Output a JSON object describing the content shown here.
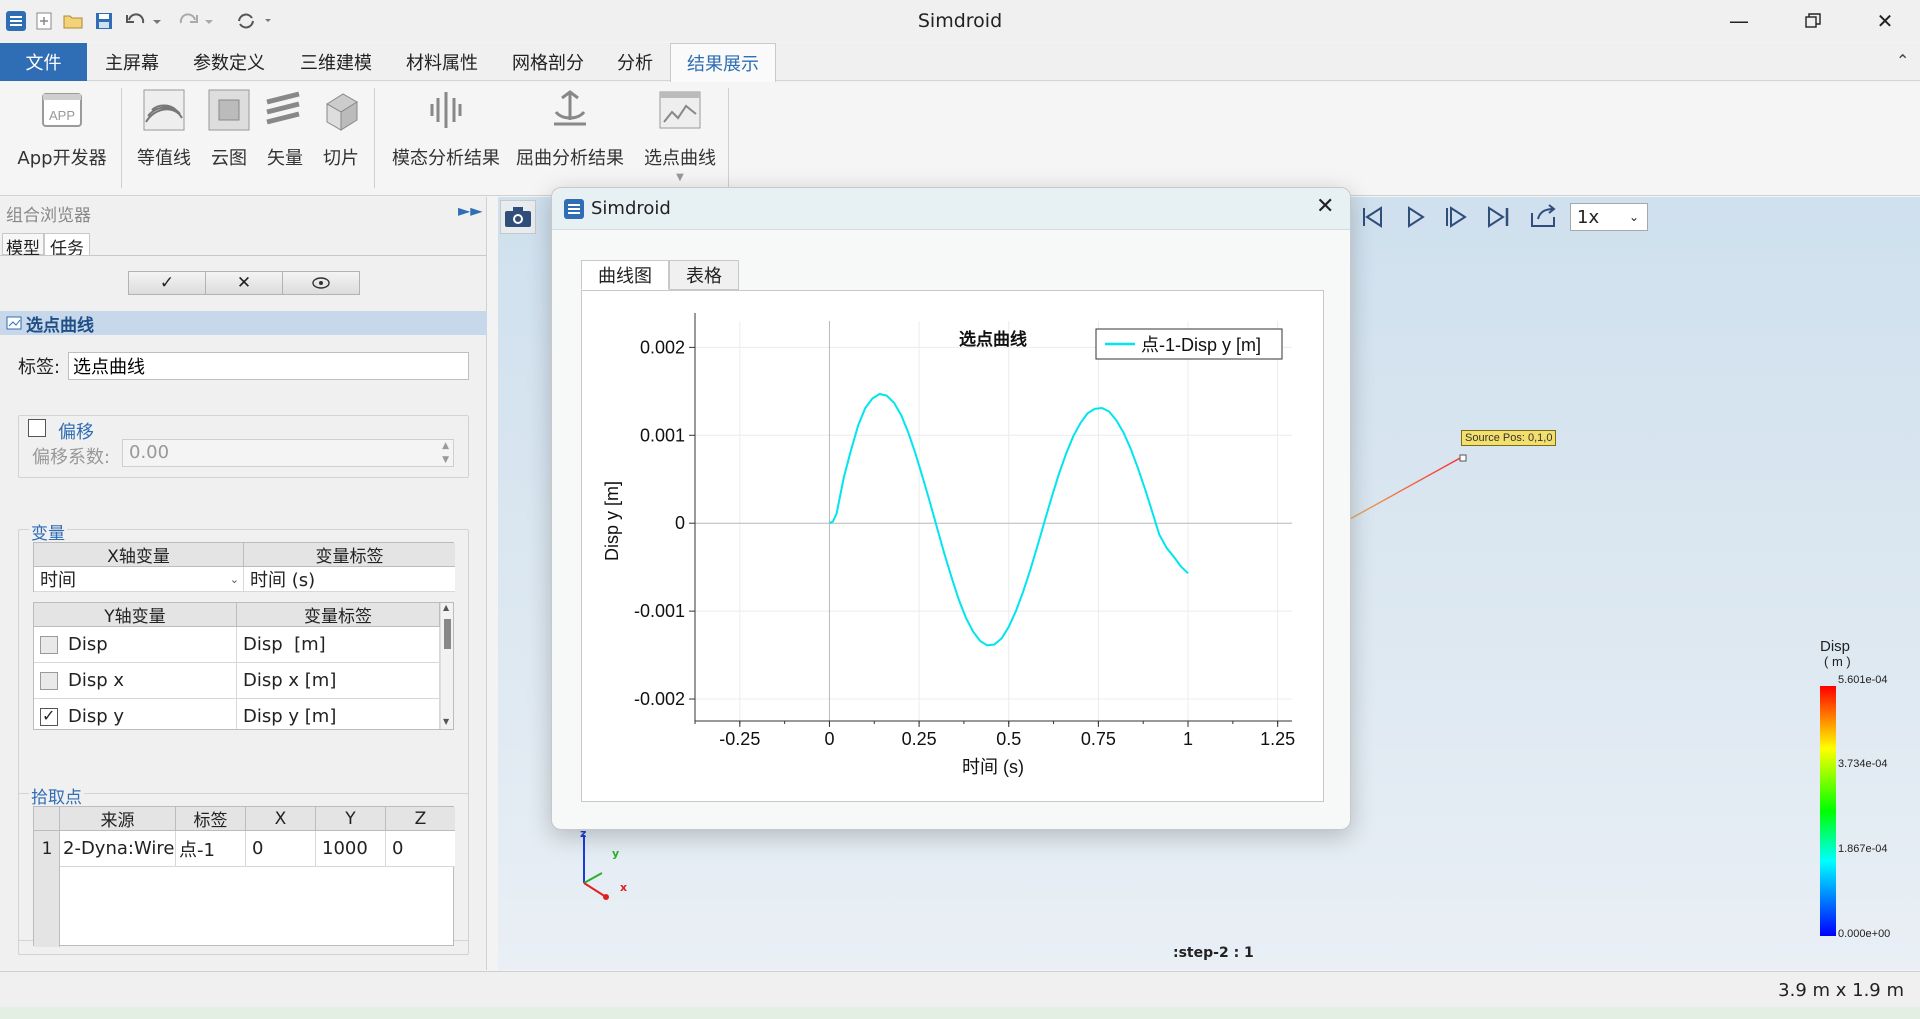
{
  "window": {
    "title": "Simdroid"
  },
  "menu": {
    "file": "文件",
    "items": [
      "主屏幕",
      "参数定义",
      "三维建模",
      "材料属性",
      "网格剖分",
      "分析"
    ],
    "active": "结果展示"
  },
  "ribbon": {
    "buttons": [
      "App开发器",
      "等值线",
      "云图",
      "矢量",
      "切片",
      "模态分析结果",
      "屈曲分析结果",
      "选点曲线"
    ],
    "app_icon_text": "APP"
  },
  "left_panel": {
    "header": "组合浏览器",
    "tabs": [
      "模型",
      "任务"
    ],
    "section_title": "选点曲线",
    "label_caption": "标签:",
    "label_value": "选点曲线",
    "offset": {
      "title": "偏移",
      "coef_caption": "偏移系数:",
      "coef_value": "0.00",
      "checked": false
    },
    "variables": {
      "title": "变量",
      "x_headers": [
        "X轴变量",
        "变量标签"
      ],
      "x_row": [
        "时间",
        "时间 (s)"
      ],
      "y_headers": [
        "Y轴变量",
        "变量标签"
      ],
      "y_rows": [
        {
          "name": "Disp",
          "label": "Disp  [m]",
          "checked": false
        },
        {
          "name": "Disp x",
          "label": "Disp x [m]",
          "checked": false
        },
        {
          "name": "Disp y",
          "label": "Disp y [m]",
          "checked": true
        }
      ]
    },
    "pick_points": {
      "title": "拾取点",
      "headers": [
        "来源",
        "标签",
        "X",
        "Y",
        "Z"
      ],
      "rows": [
        {
          "index": "1",
          "cells": [
            "2-Dyna:Wire",
            "点-1",
            "0",
            "1000",
            "0"
          ]
        }
      ]
    }
  },
  "viewport": {
    "speed": "1x",
    "source_label": "Source Pos: 0,1,0",
    "step_label": ":step-2 : 1",
    "axes": {
      "x": "x",
      "y": "y",
      "z": "z"
    },
    "legend": {
      "title": "Disp",
      "unit": "( m )",
      "ticks": [
        "5.601e-04",
        "3.734e-04",
        "1.867e-04",
        "0.000e+00"
      ]
    }
  },
  "dialog": {
    "title": "Simdroid",
    "tabs": [
      "曲线图",
      "表格"
    ]
  },
  "status": {
    "dimensions": "3.9 m x 1.9 m"
  },
  "chart_data": {
    "type": "line",
    "title": "选点曲线",
    "xlabel": "时间 (s)",
    "ylabel": "Disp y [m]",
    "xlim": [
      -0.375,
      1.29
    ],
    "ylim": [
      -0.00225,
      0.0023
    ],
    "xticks": [
      "-0.25",
      "0",
      "0.25",
      "0.5",
      "0.75",
      "1",
      "1.25"
    ],
    "xtick_values": [
      -0.25,
      0,
      0.25,
      0.5,
      0.75,
      1,
      1.25
    ],
    "yticks": [
      "0.002",
      "0.001",
      "0",
      "-0.001",
      "-0.002"
    ],
    "ytick_values": [
      0.002,
      0.001,
      0,
      -0.001,
      -0.002
    ],
    "grid": true,
    "legend_position": "top-right",
    "series": [
      {
        "name": "点-1-Disp y [m]",
        "color": "#00e5ee",
        "x": [
          0,
          0.01,
          0.02,
          0.04,
          0.06,
          0.08,
          0.1,
          0.12,
          0.14,
          0.16,
          0.18,
          0.2,
          0.22,
          0.24,
          0.26,
          0.28,
          0.3,
          0.32,
          0.34,
          0.36,
          0.38,
          0.4,
          0.42,
          0.44,
          0.46,
          0.48,
          0.5,
          0.52,
          0.54,
          0.56,
          0.58,
          0.6,
          0.62,
          0.64,
          0.66,
          0.68,
          0.7,
          0.72,
          0.74,
          0.76,
          0.78,
          0.8,
          0.82,
          0.84,
          0.86,
          0.88,
          0.9,
          0.92,
          0.94,
          0.96,
          0.98,
          1.0
        ],
        "y": [
          0,
          2e-05,
          0.00011,
          0.00052,
          0.00083,
          0.00111,
          0.00131,
          0.00142,
          0.00147,
          0.00145,
          0.00137,
          0.00123,
          0.00103,
          0.00079,
          0.00052,
          0.00024,
          -5e-05,
          -0.00034,
          -0.00061,
          -0.00086,
          -0.00107,
          -0.00123,
          -0.00134,
          -0.00139,
          -0.00138,
          -0.00131,
          -0.00118,
          -0.001,
          -0.00078,
          -0.00053,
          -0.00026,
          2e-05,
          0.0003,
          0.00056,
          0.00079,
          0.00099,
          0.00114,
          0.00125,
          0.0013,
          0.00131,
          0.00127,
          0.00117,
          0.00103,
          0.00085,
          0.00063,
          0.00039,
          0.00013,
          -0.00013,
          -0.00028,
          -0.00038,
          -0.00049,
          -0.00057
        ]
      }
    ]
  }
}
